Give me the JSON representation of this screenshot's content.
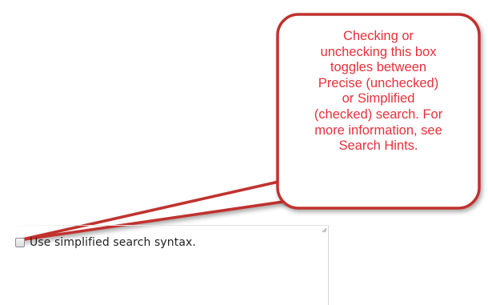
{
  "callout": {
    "text": "Checking or\nunchecking this box\ntoggles between\nPrecise (unchecked)\nor Simplified\n(checked) search.  For\nmore information, see\nSearch Hints.",
    "border_color": "#c0302f",
    "fill_color": "#ffffff",
    "text_color": "#e8303a"
  },
  "search_options": {
    "simplified_syntax": {
      "label": "Use simplified search syntax.",
      "checked": false
    }
  }
}
